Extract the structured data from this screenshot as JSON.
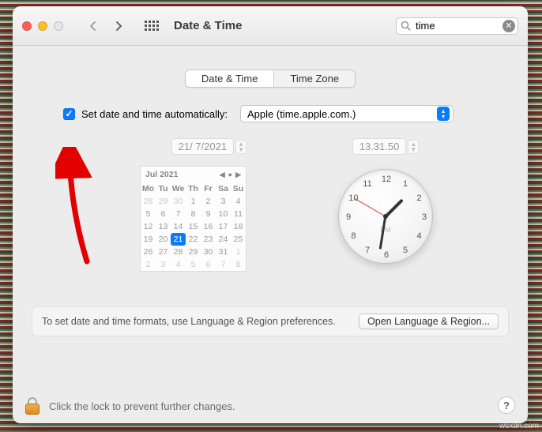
{
  "header": {
    "title": "Date & Time",
    "search_value": "time"
  },
  "tabs": {
    "datetime": "Date & Time",
    "timezone": "Time Zone"
  },
  "auto": {
    "label": "Set date and time automatically:",
    "server": "Apple (time.apple.com.)"
  },
  "date": {
    "field": "21/  7/2021",
    "month_label": "Jul 2021",
    "weekdays": [
      "Mo",
      "Tu",
      "We",
      "Th",
      "Fr",
      "Sa",
      "Su"
    ],
    "grid": [
      {
        "n": "28",
        "out": true
      },
      {
        "n": "29",
        "out": true
      },
      {
        "n": "30",
        "out": true
      },
      {
        "n": "1"
      },
      {
        "n": "2"
      },
      {
        "n": "3"
      },
      {
        "n": "4"
      },
      {
        "n": "5"
      },
      {
        "n": "6"
      },
      {
        "n": "7"
      },
      {
        "n": "8"
      },
      {
        "n": "9"
      },
      {
        "n": "10"
      },
      {
        "n": "11"
      },
      {
        "n": "12"
      },
      {
        "n": "13"
      },
      {
        "n": "14"
      },
      {
        "n": "15"
      },
      {
        "n": "16"
      },
      {
        "n": "17"
      },
      {
        "n": "18"
      },
      {
        "n": "19"
      },
      {
        "n": "20"
      },
      {
        "n": "21",
        "today": true
      },
      {
        "n": "22"
      },
      {
        "n": "23"
      },
      {
        "n": "24"
      },
      {
        "n": "25"
      },
      {
        "n": "26"
      },
      {
        "n": "27"
      },
      {
        "n": "28"
      },
      {
        "n": "29"
      },
      {
        "n": "30"
      },
      {
        "n": "31"
      },
      {
        "n": "1",
        "out": true
      },
      {
        "n": "2",
        "out": true
      },
      {
        "n": "3",
        "out": true
      },
      {
        "n": "4",
        "out": true
      },
      {
        "n": "5",
        "out": true
      },
      {
        "n": "6",
        "out": true
      },
      {
        "n": "7",
        "out": true
      },
      {
        "n": "8",
        "out": true
      }
    ]
  },
  "time": {
    "field": "13.31.50",
    "ampm": "PM",
    "clock_numbers": [
      "12",
      "1",
      "2",
      "3",
      "4",
      "5",
      "6",
      "7",
      "8",
      "9",
      "10",
      "11"
    ],
    "hour_angle": 45,
    "minute_angle": 189,
    "second_angle": 300
  },
  "footer": {
    "note": "To set date and time formats, use Language & Region preferences.",
    "button": "Open Language & Region..."
  },
  "lock": {
    "text": "Click the lock to prevent further changes."
  },
  "watermark": "wsxdn.com"
}
